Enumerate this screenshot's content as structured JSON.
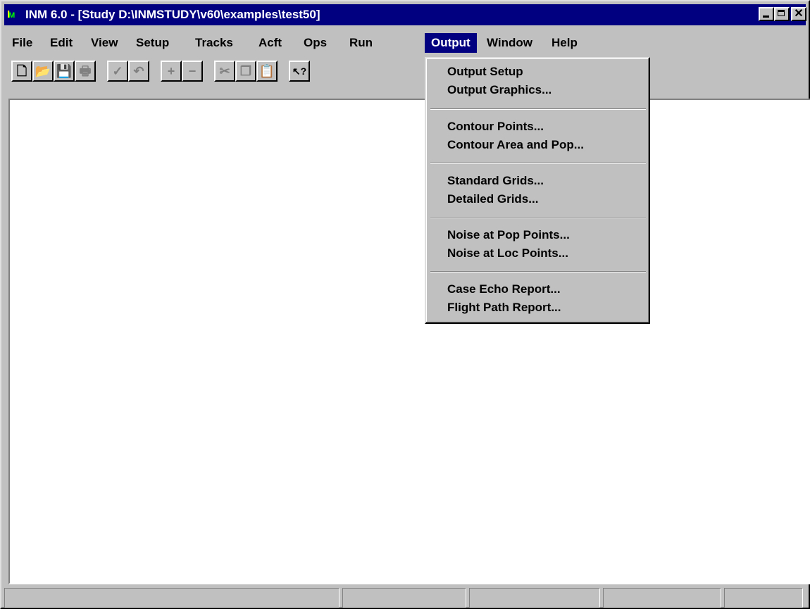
{
  "window": {
    "title": "INM 6.0 - [Study D:\\INMSTUDY\\v60\\examples\\test50]",
    "icon": "inm-app-icon",
    "close_glyph": "✕"
  },
  "menu": {
    "items": [
      "File",
      "Edit",
      "View",
      "Setup",
      "Tracks",
      "Acft",
      "Ops",
      "Run",
      "Output",
      "Window",
      "Help"
    ],
    "active": "Output"
  },
  "toolbar": {
    "buttons": [
      {
        "name": "new-icon",
        "glyph": "🗋"
      },
      {
        "name": "open-icon",
        "glyph": "📂"
      },
      {
        "name": "save-icon",
        "glyph": "💾"
      },
      {
        "name": "print-icon",
        "glyph": "🖶"
      },
      {
        "name": "check-icon",
        "glyph": "✓"
      },
      {
        "name": "undo-icon",
        "glyph": "↶"
      },
      {
        "name": "plus-icon",
        "glyph": "+"
      },
      {
        "name": "minus-icon",
        "glyph": "−"
      },
      {
        "name": "cut-icon",
        "glyph": "✂"
      },
      {
        "name": "copy-icon",
        "glyph": "❐"
      },
      {
        "name": "paste-icon",
        "glyph": "📋"
      },
      {
        "name": "context-help-icon",
        "glyph": "↖?"
      }
    ]
  },
  "output_menu": {
    "groups": [
      [
        "Output Setup",
        "Output Graphics..."
      ],
      [
        "Contour Points...",
        "Contour Area and Pop..."
      ],
      [
        "Standard Grids...",
        "Detailed Grids..."
      ],
      [
        "Noise at Pop Points...",
        "Noise at Loc Points..."
      ],
      [
        "Case Echo Report...",
        "Flight Path Report..."
      ]
    ]
  }
}
